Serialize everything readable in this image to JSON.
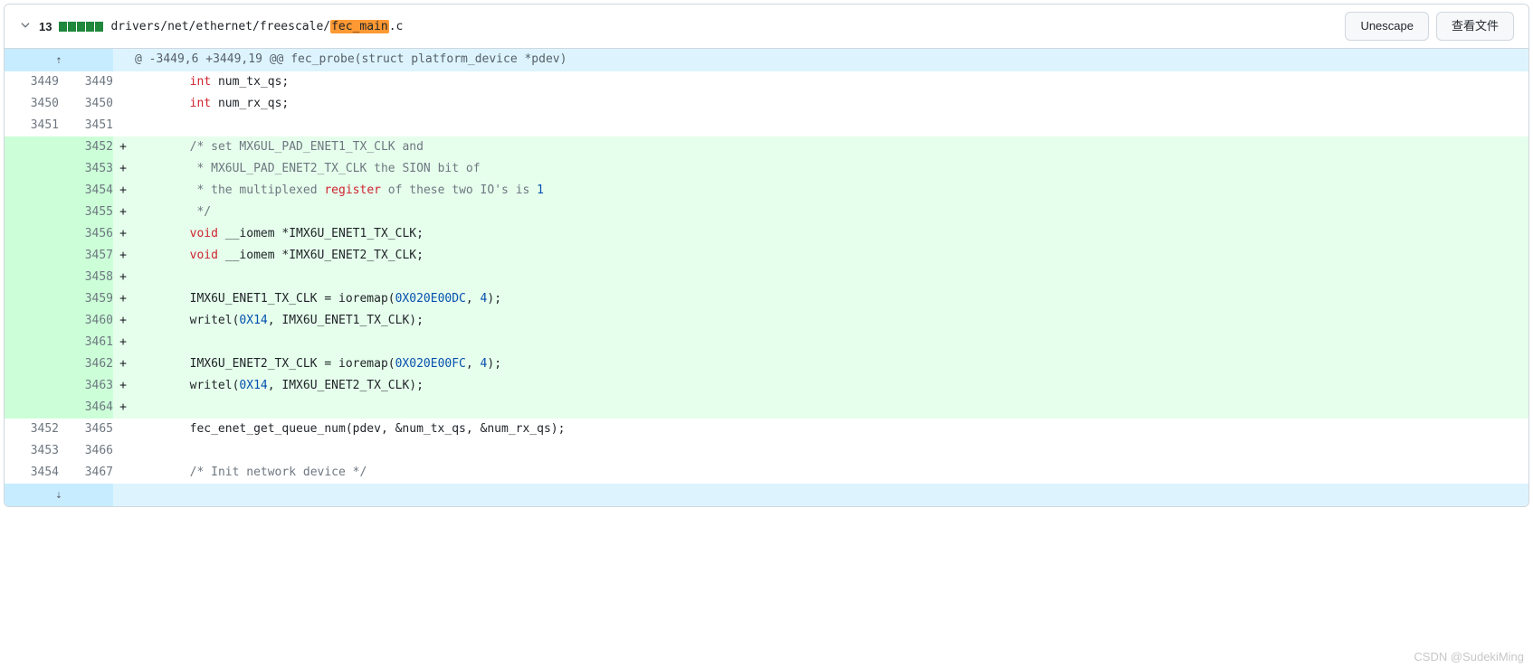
{
  "header": {
    "diff_count": "13",
    "filepath_prefix": "drivers/net/ethernet/freescale/",
    "filepath_highlight": "fec_main",
    "filepath_suffix": ".c",
    "btn_unescape": "Unescape",
    "btn_view_file": "查看文件"
  },
  "hunk": {
    "text": "@ -3449,6 +3449,19 @@ fec_probe(struct platform_device *pdev)"
  },
  "lines": [
    {
      "old": "3449",
      "new": "3449",
      "type": "ctx",
      "html": "        <span class='kw'>int</span> num_tx_qs;"
    },
    {
      "old": "3450",
      "new": "3450",
      "type": "ctx",
      "html": "        <span class='kw'>int</span> num_rx_qs;"
    },
    {
      "old": "3451",
      "new": "3451",
      "type": "ctx",
      "html": ""
    },
    {
      "old": "",
      "new": "3452",
      "type": "add",
      "html": "        <span class='cm'>/* set MX6UL_PAD_ENET1_TX_CLK and</span>"
    },
    {
      "old": "",
      "new": "3453",
      "type": "add",
      "html": "         <span class='cm'>* MX6UL_PAD_ENET2_TX_CLK the SION bit of</span>"
    },
    {
      "old": "",
      "new": "3454",
      "type": "add",
      "html": "         <span class='cm'>* the multiplexed <span class='cm-kw'>register</span> of these two IO's is <span class='cm-num'>1</span></span>"
    },
    {
      "old": "",
      "new": "3455",
      "type": "add",
      "html": "         <span class='cm'>*/</span>"
    },
    {
      "old": "",
      "new": "3456",
      "type": "add",
      "html": "        <span class='kw'>void</span> __iomem *IMX6U_ENET1_TX_CLK;"
    },
    {
      "old": "",
      "new": "3457",
      "type": "add",
      "html": "        <span class='kw'>void</span> __iomem *IMX6U_ENET2_TX_CLK;"
    },
    {
      "old": "",
      "new": "3458",
      "type": "add",
      "html": ""
    },
    {
      "old": "",
      "new": "3459",
      "type": "add",
      "html": "        IMX6U_ENET1_TX_CLK = ioremap(<span class='num'>0X020E00DC</span>, <span class='num'>4</span>);"
    },
    {
      "old": "",
      "new": "3460",
      "type": "add",
      "html": "        writel(<span class='num'>0X14</span>, IMX6U_ENET1_TX_CLK);"
    },
    {
      "old": "",
      "new": "3461",
      "type": "add",
      "html": ""
    },
    {
      "old": "",
      "new": "3462",
      "type": "add",
      "html": "        IMX6U_ENET2_TX_CLK = ioremap(<span class='num'>0X020E00FC</span>, <span class='num'>4</span>);"
    },
    {
      "old": "",
      "new": "3463",
      "type": "add",
      "html": "        writel(<span class='num'>0X14</span>, IMX6U_ENET2_TX_CLK);"
    },
    {
      "old": "",
      "new": "3464",
      "type": "add",
      "html": ""
    },
    {
      "old": "3452",
      "new": "3465",
      "type": "ctx",
      "html": "        fec_enet_get_queue_num(pdev, &amp;num_tx_qs, &amp;num_rx_qs);"
    },
    {
      "old": "3453",
      "new": "3466",
      "type": "ctx",
      "html": ""
    },
    {
      "old": "3454",
      "new": "3467",
      "type": "ctx",
      "html": "        <span class='cm'>/* Init network device */</span>"
    }
  ],
  "expand_up_icon": "⇡",
  "expand_down_icon": "⇣",
  "watermark": "CSDN @SudekiMing"
}
